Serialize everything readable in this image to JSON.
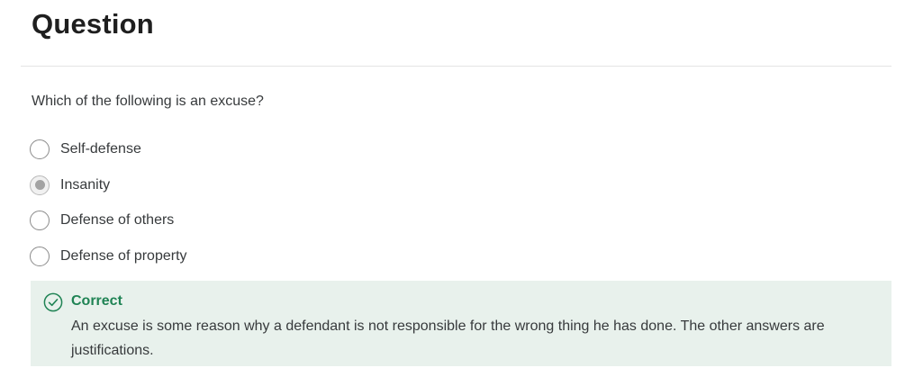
{
  "header": {
    "title": "Question"
  },
  "question": {
    "prompt": "Which of the following is an excuse?",
    "options": [
      {
        "label": "Self-defense",
        "selected": false
      },
      {
        "label": "Insanity",
        "selected": true
      },
      {
        "label": "Defense of others",
        "selected": false
      },
      {
        "label": "Defense of property",
        "selected": false
      }
    ]
  },
  "feedback": {
    "status": "Correct",
    "explanation": "An excuse is some reason why a defendant is not responsible for the wrong thing he has done. The other answers are justifications.",
    "icon": "check-circle-icon",
    "accent_color": "#1f8354",
    "background_color": "#e8f1ec"
  }
}
